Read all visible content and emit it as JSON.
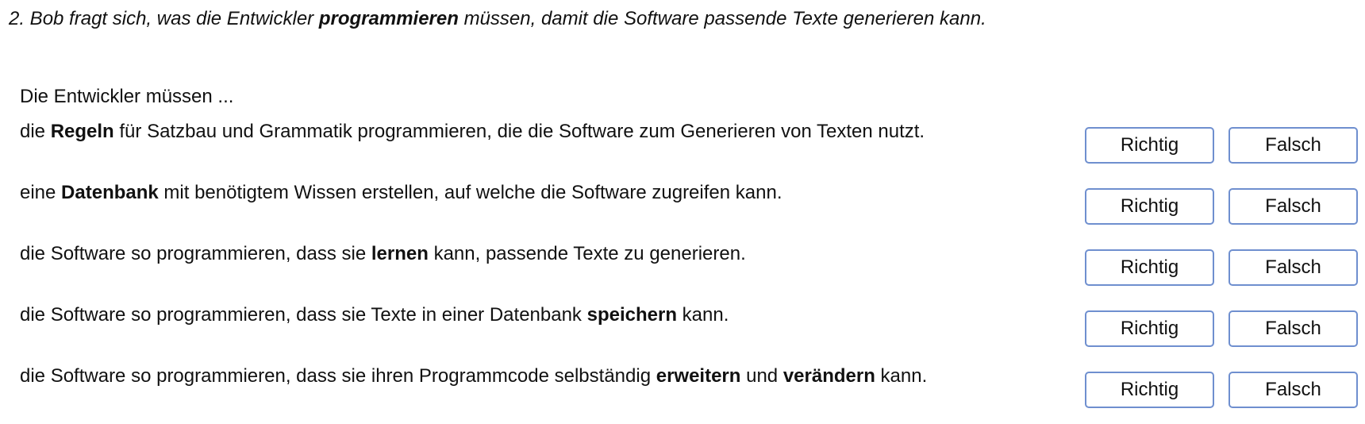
{
  "question": {
    "prefix": "2. Bob fragt sich, was die Entwickler ",
    "bold": "programmieren",
    "suffix": " müssen, damit die Software passende Texte generieren kann."
  },
  "intro": "Die Entwickler müssen ...",
  "buttons": {
    "true_label": "Richtig",
    "false_label": "Falsch"
  },
  "statements": [
    {
      "parts": [
        {
          "text": "die ",
          "bold": false
        },
        {
          "text": "Regeln",
          "bold": true
        },
        {
          "text": " für Satzbau und Grammatik programmieren, die die Software zum Generieren von Texten nutzt.",
          "bold": false
        }
      ]
    },
    {
      "parts": [
        {
          "text": "eine ",
          "bold": false
        },
        {
          "text": "Datenbank",
          "bold": true
        },
        {
          "text": " mit benötigtem Wissen erstellen, auf welche die Software zugreifen kann.",
          "bold": false
        }
      ]
    },
    {
      "parts": [
        {
          "text": "die Software so programmieren, dass sie ",
          "bold": false
        },
        {
          "text": "lernen",
          "bold": true
        },
        {
          "text": " kann, passende Texte zu generieren.",
          "bold": false
        }
      ]
    },
    {
      "parts": [
        {
          "text": "die Software so programmieren, dass sie Texte in einer Datenbank ",
          "bold": false
        },
        {
          "text": "speichern",
          "bold": true
        },
        {
          "text": " kann.",
          "bold": false
        }
      ]
    },
    {
      "parts": [
        {
          "text": "die Software so programmieren, dass sie ihren Programmcode selbständig ",
          "bold": false
        },
        {
          "text": "erweitern",
          "bold": true
        },
        {
          "text": " und ",
          "bold": false
        },
        {
          "text": "verändern",
          "bold": true
        },
        {
          "text": " kann.",
          "bold": false
        }
      ]
    }
  ]
}
